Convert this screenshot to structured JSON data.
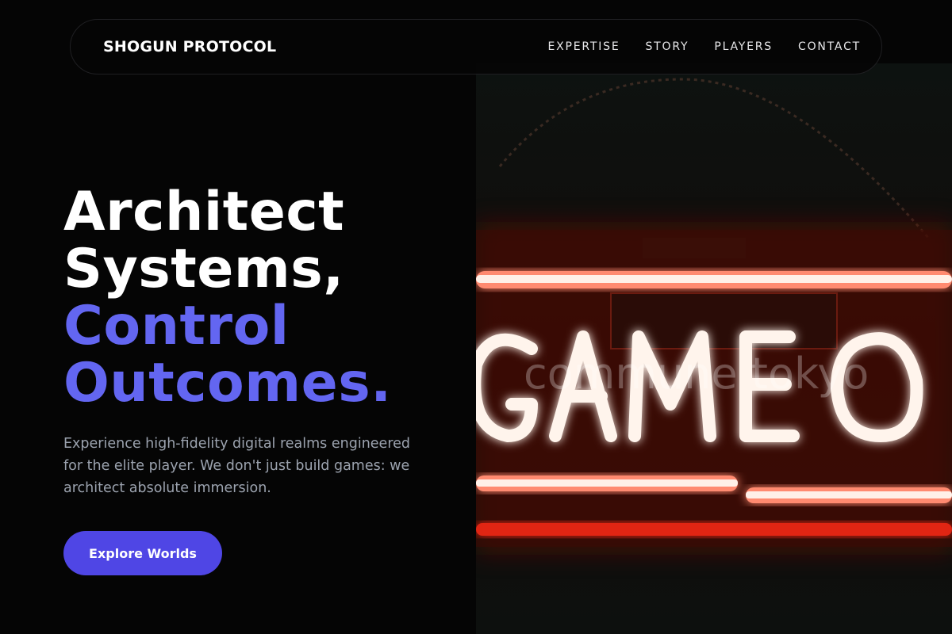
{
  "nav": {
    "brand": "SHOGUN PROTOCOL",
    "links": [
      "EXPERTISE",
      "STORY",
      "PLAYERS",
      "CONTACT"
    ]
  },
  "hero": {
    "headline": {
      "line1": "Architect",
      "line2": "Systems,",
      "line3": "Control",
      "line4": "Outcomes."
    },
    "subtext": "Experience high-fidelity digital realms engineered for the elite player. We don't just build games: we architect absolute immersion.",
    "cta_label": "Explore Worlds"
  },
  "image": {
    "sign_text": "GAMEO",
    "watermark": "commune tokyo"
  },
  "colors": {
    "accent": "#6366f1",
    "button": "#4f46e5",
    "background": "#050505",
    "neon_red": "#ff3b1f",
    "neon_white": "#fff4ec"
  }
}
